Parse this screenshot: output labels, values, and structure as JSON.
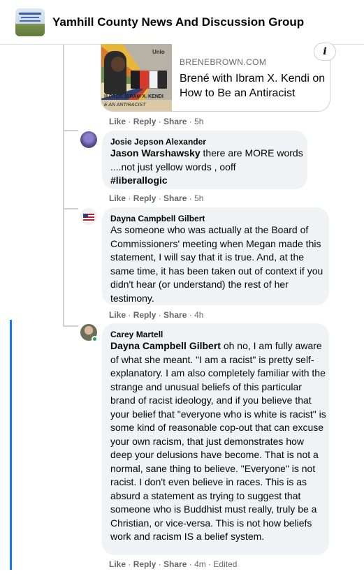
{
  "header": {
    "group_name": "Yamhill County News And Discussion Group"
  },
  "link_card": {
    "image_text_top": "Unlo",
    "image_caption_1": "H PROF. IBRAM X. KENDI",
    "image_caption_2": "E AN ANTIRACIST",
    "domain": "BRENEBROWN.COM",
    "title": "Brené with Ibram X. Kendi on How to Be an Antiracist",
    "info_icon": "info-icon"
  },
  "comments": [
    {
      "author": "",
      "actions": {
        "like": "Like",
        "reply": "Reply",
        "share": "Share",
        "time": "5h",
        "edited": ""
      }
    },
    {
      "author": "Josie Jepson Alexander",
      "mention": "Jason Warshawsky",
      "text": " there are MORE words ....not just yellow words , ooff",
      "hashtag": "#liberallogic",
      "actions": {
        "like": "Like",
        "reply": "Reply",
        "share": "Share",
        "time": "5h",
        "edited": ""
      }
    },
    {
      "author": "Dayna Campbell Gilbert",
      "mention": "",
      "text": "As someone who was actually at the Board of Commissioners' meeting when Megan made this statement, I will say that it is true. And, at the same time, it has been taken out of context if you didn't hear (or understand) the rest of her testimony.",
      "actions": {
        "like": "Like",
        "reply": "Reply",
        "share": "Share",
        "time": "4h",
        "edited": ""
      }
    },
    {
      "author": "Carey Martell",
      "mention": "Dayna Campbell Gilbert",
      "text": " oh no, I am fully aware of what she meant. \"I am a racist\" is pretty self-explanatory. I am also completely familiar with the strange and unusual beliefs of this particular brand of racist ideology, and if you believe that your belief that \"everyone who is white is racist\" is some kind of reasonable cop-out that can excuse your own racism, that just demonstrates how deep your delusions have become. That is not a normal, sane thing to believe. \"Everyone\" is not racist. I don't even believe in races. This is as absurd a statement as trying to suggest that someone who is Buddhist must really, truly be a Christian, or vice-versa. This is not how beliefs work and racism IS a belief system.",
      "actions": {
        "like": "Like",
        "reply": "Reply",
        "share": "Share",
        "time": "4m",
        "edited": "Edited"
      }
    }
  ],
  "separator": " · ",
  "colors": {
    "bubble_bg": "#f0f2f5",
    "meta_text": "#65676b",
    "thread_line": "#ced0d4",
    "active_line": "#1877f2",
    "online": "#31a24c"
  }
}
